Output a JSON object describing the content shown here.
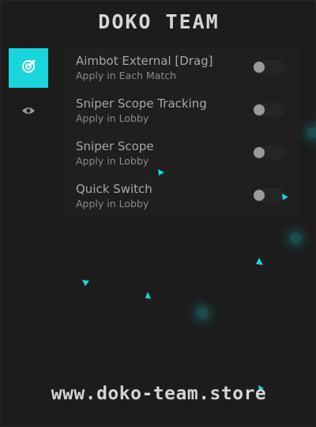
{
  "header": {
    "title": "DOKO TEAM"
  },
  "sidebar": {
    "items": [
      {
        "icon": "target-icon",
        "active": true
      },
      {
        "icon": "eye-icon",
        "active": false
      }
    ]
  },
  "features": [
    {
      "label": "Aimbot External [Drag]",
      "sub": "Apply in Each Match",
      "enabled": false
    },
    {
      "label": "Sniper Scope Tracking",
      "sub": "Apply in Lobby",
      "enabled": false
    },
    {
      "label": "Sniper Scope",
      "sub": "Apply in Lobby",
      "enabled": false
    },
    {
      "label": "Quick Switch",
      "sub": "Apply in Lobby",
      "enabled": false
    }
  ],
  "footer": {
    "url": "www.doko-team.store"
  },
  "colors": {
    "accent": "#18d6dc",
    "background": "#1c1c1c",
    "text": "#a7a7a7"
  }
}
